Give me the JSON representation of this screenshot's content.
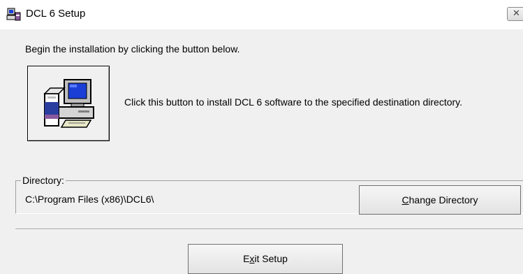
{
  "window": {
    "title": "DCL 6 Setup",
    "close_icon": "close-icon"
  },
  "intro_text": "Begin the installation by clicking the button below.",
  "install": {
    "icon": "computer-setup-icon",
    "description": "Click this button to install DCL 6 software to the specified destination directory."
  },
  "directory": {
    "label": "Directory:",
    "path": "C:\\Program Files (x86)\\DCL6\\",
    "change_button_label": "Change Directory",
    "change_button_accesskey": "C"
  },
  "exit_button_label": "Exit Setup",
  "exit_button_accesskey": "x",
  "colors": {
    "dialog_background": "#f0f0f0",
    "titlebar_background": "#ffffff",
    "monitor_screen": "#1b3fd6"
  }
}
